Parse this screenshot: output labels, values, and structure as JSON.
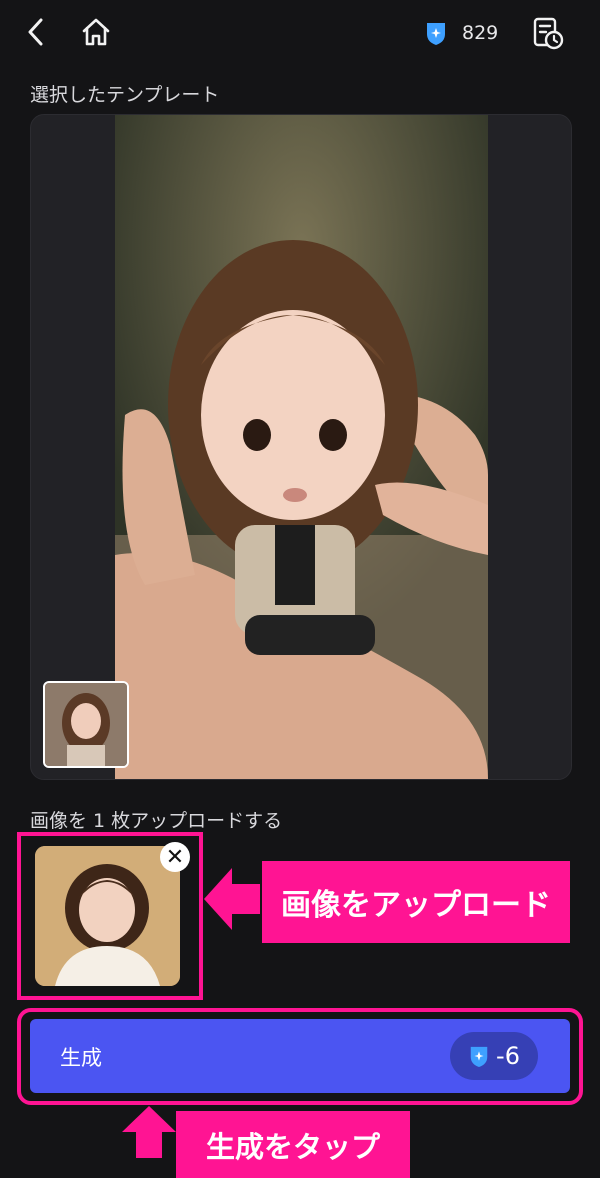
{
  "header": {
    "credits": "829"
  },
  "template_section": {
    "label": "選択したテンプレート"
  },
  "upload_section": {
    "label": "画像を 1 枚アップロードする"
  },
  "callouts": {
    "upload": "画像をアップロード",
    "tap": "生成をタップ"
  },
  "generate": {
    "label": "生成",
    "cost": "-6"
  },
  "colors": {
    "accent": "#ff1493",
    "button": "#4b55f2",
    "credit_icon": "#3ea0ff"
  },
  "icons": [
    "back-arrow-icon",
    "home-icon",
    "credit-badge-icon",
    "history-icon",
    "close-icon",
    "arrow-left-icon",
    "arrow-up-icon"
  ]
}
